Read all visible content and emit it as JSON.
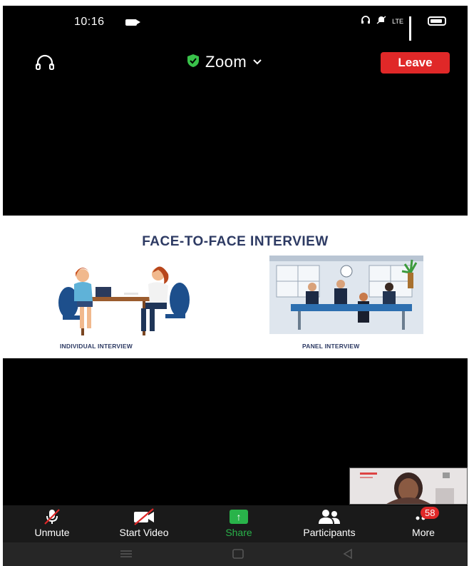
{
  "status_bar": {
    "time": "10:16",
    "network": "LTE"
  },
  "header": {
    "app_title": "Zoom",
    "leave_label": "Leave",
    "shield_color": "#39c24a",
    "leave_color": "#e02828"
  },
  "slide": {
    "title": "FACE-TO-FACE INTERVIEW",
    "left_caption": "INDIVIDUAL INTERVIEW",
    "right_caption": "PANEL INTERVIEW"
  },
  "toolbar": {
    "unmute_label": "Unmute",
    "start_video_label": "Start Video",
    "share_label": "Share",
    "participants_label": "Participants",
    "more_label": "More",
    "participant_badge": "58"
  },
  "icons": [
    "headset-icon",
    "shield-icon",
    "chevron-down-icon",
    "mic-muted-icon",
    "video-off-icon",
    "share-arrow-icon",
    "participants-icon",
    "more-dots-icon",
    "menu-icon",
    "home-icon",
    "back-icon"
  ]
}
